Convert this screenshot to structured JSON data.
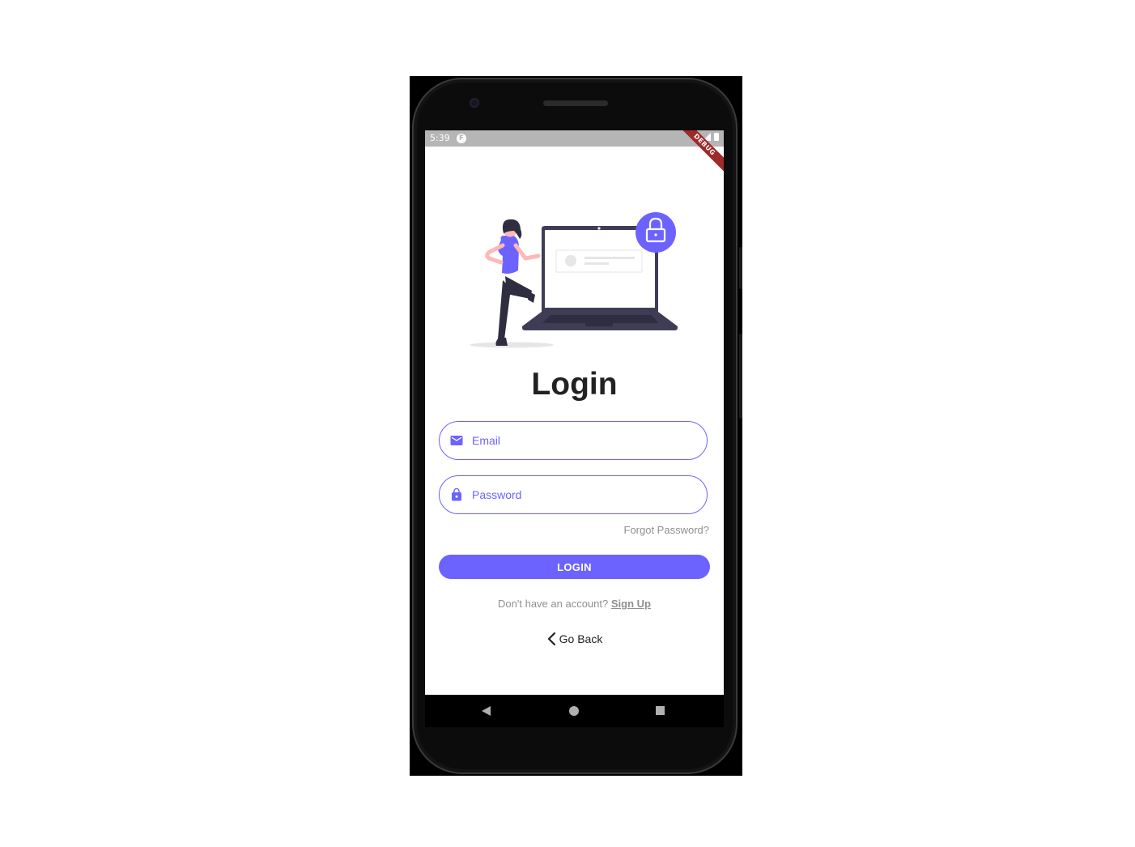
{
  "status_bar": {
    "time": "5:39",
    "app_icon_letter": "F",
    "debug_banner": "DEBUG"
  },
  "illustration": {
    "name": "login-illustration"
  },
  "login_form": {
    "title": "Login",
    "email": {
      "placeholder": "Email",
      "value": "",
      "icon": "mail-icon"
    },
    "password": {
      "placeholder": "Password",
      "value": "",
      "icon": "lock-icon"
    },
    "forgot_password": "Forgot Password?",
    "login_button": "LOGIN",
    "signup_prompt": "Don't have an account?",
    "signup_link": "Sign Up",
    "go_back": "Go Back"
  },
  "colors": {
    "accent": "#6C63FF",
    "muted_text": "#8F8F8F",
    "title_text": "#222222",
    "status_bar": "#B5B5B5",
    "debug_banner": "#9E2A2A"
  },
  "nav_bar": {
    "items": [
      "back-icon",
      "home-icon",
      "recents-icon"
    ]
  }
}
